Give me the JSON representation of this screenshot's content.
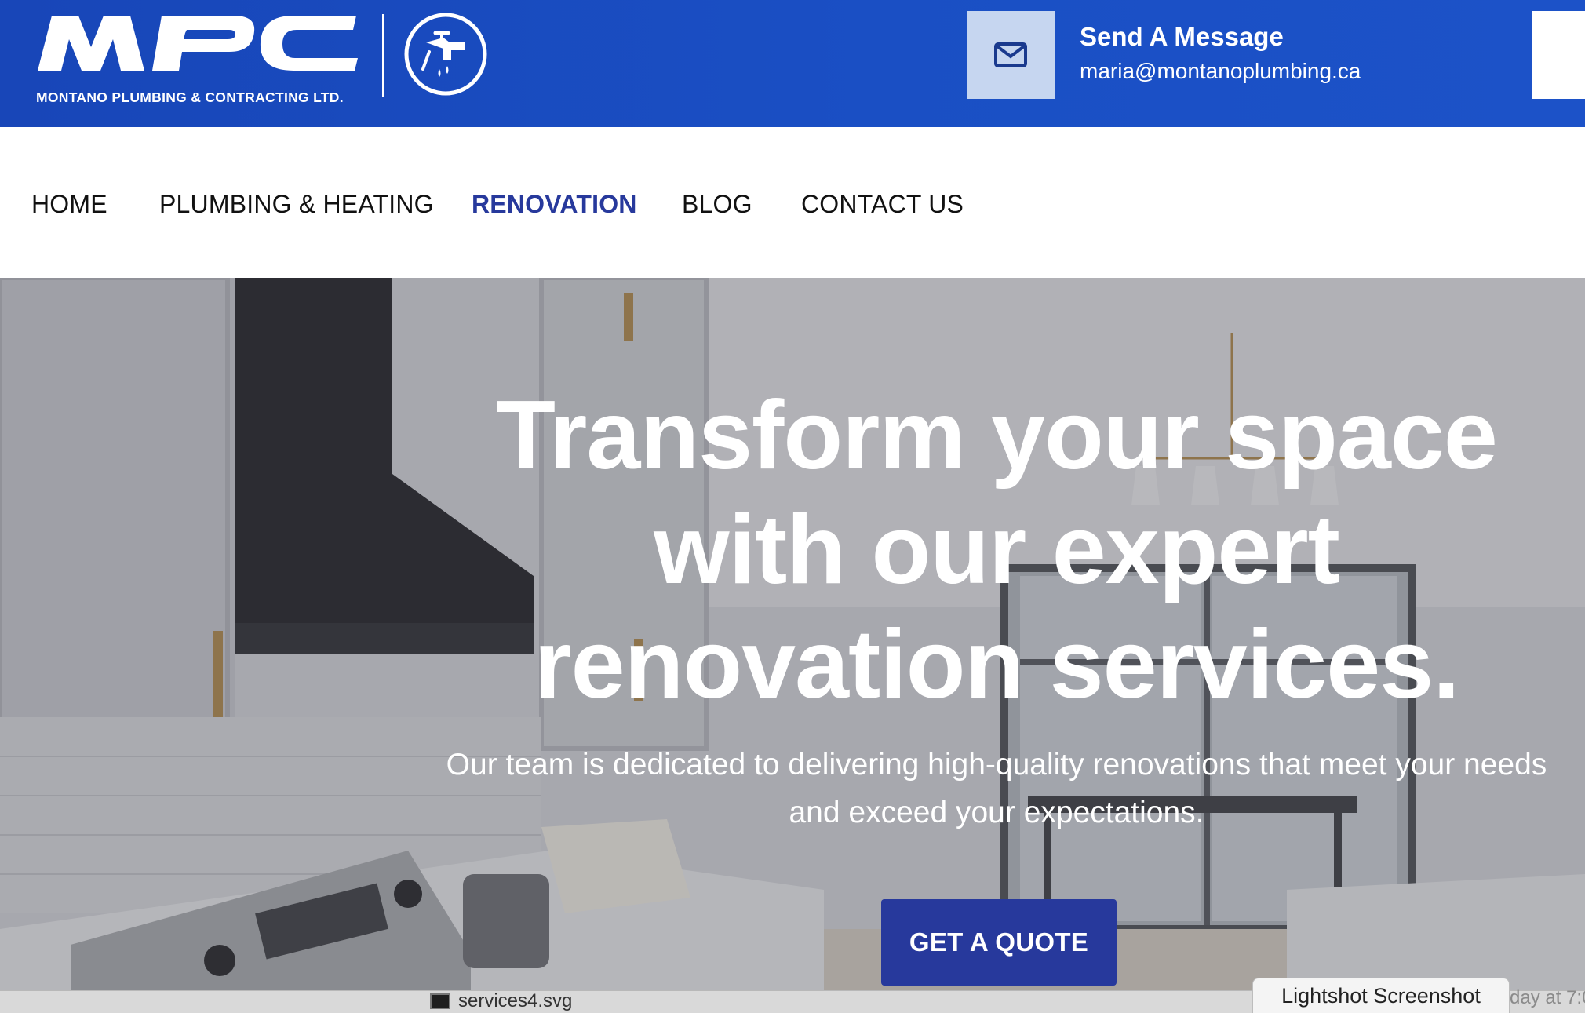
{
  "header": {
    "logo_text": "MPC",
    "company_name": "MONTANO PLUMBING & CONTRACTING LTD.",
    "message_title": "Send A Message",
    "message_email": "maria@montanoplumbing.ca",
    "brand_color": "#1a4fc4",
    "mail_icon": "envelope-icon",
    "badge_icon": "faucet-icon"
  },
  "nav": {
    "items": [
      {
        "label": "HOME",
        "active": false
      },
      {
        "label": "PLUMBING & HEATING",
        "active": false
      },
      {
        "label": "RENOVATION",
        "active": true
      },
      {
        "label": "BLOG",
        "active": false
      },
      {
        "label": "CONTACT US",
        "active": false
      }
    ],
    "active_color": "#27399c"
  },
  "hero": {
    "title": "Transform your space with our expert renovation services.",
    "subtitle": "Our team is dedicated to delivering high-quality renovations that meet your needs and exceed your expectations.",
    "cta_label": "GET A QUOTE",
    "cta_color": "#27399c"
  },
  "overlay": {
    "file_name": "services4.svg",
    "tooltip": "Lightshot Screenshot",
    "date_fragment": "day at 7:0"
  }
}
